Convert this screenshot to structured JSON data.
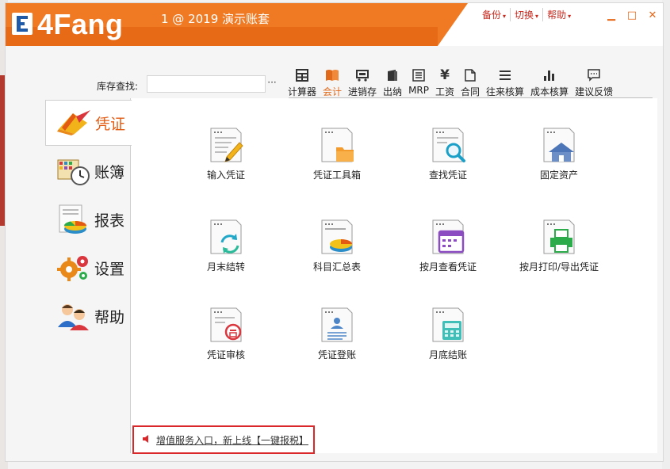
{
  "app": {
    "brand": "4Fang",
    "window_title": "1 @ 2019 演示账套",
    "colors": {
      "brand_orange": "#ef7a23",
      "accent_red": "#d9272a",
      "menu_red": "#c8281c"
    }
  },
  "top_menus": [
    {
      "label": "备份",
      "caret": "▾"
    },
    {
      "label": "切换",
      "caret": "▾"
    },
    {
      "label": "帮助",
      "caret": "▾"
    }
  ],
  "window_controls": {
    "minimize": "▁",
    "maximize": "□",
    "close": "✕"
  },
  "search": {
    "label": "库存查找:",
    "value": "",
    "more": "···"
  },
  "toolbar": [
    {
      "label": "计算器",
      "icon": "calculator-icon",
      "glyph": "▦",
      "active": false
    },
    {
      "label": "会计",
      "icon": "book-icon",
      "glyph": "📖",
      "active": true
    },
    {
      "label": "进销存",
      "icon": "cart-icon",
      "glyph": "⛟",
      "active": false
    },
    {
      "label": "出纳",
      "icon": "wallet-icon",
      "glyph": "▮",
      "active": false
    },
    {
      "label": "MRP",
      "icon": "mrp-icon",
      "glyph": "▤",
      "active": false
    },
    {
      "label": "工资",
      "icon": "yen-icon",
      "glyph": "¥",
      "active": false
    },
    {
      "label": "合同",
      "icon": "document-icon",
      "glyph": "🗋",
      "active": false
    },
    {
      "label": "往来核算",
      "icon": "list-icon",
      "glyph": "☰",
      "active": false
    },
    {
      "label": "成本核算",
      "icon": "bar-chart-icon",
      "glyph": "▂▅▇",
      "active": false
    },
    {
      "label": "建议反馈",
      "icon": "chat-icon",
      "glyph": "▭",
      "active": false
    }
  ],
  "sidebar": [
    {
      "label": "凭证",
      "icon": "voucher-pen-icon",
      "active": true
    },
    {
      "label": "账簿",
      "icon": "ledger-clock-icon",
      "active": false
    },
    {
      "label": "报表",
      "icon": "report-chart-icon",
      "active": false
    },
    {
      "label": "设置",
      "icon": "gears-icon",
      "active": false
    },
    {
      "label": "帮助",
      "icon": "people-icon",
      "active": false
    }
  ],
  "functions": [
    {
      "label": "输入凭证",
      "icon": "input-voucher-icon"
    },
    {
      "label": "凭证工具箱",
      "icon": "voucher-toolbox-icon"
    },
    {
      "label": "查找凭证",
      "icon": "find-voucher-icon"
    },
    {
      "label": "固定资产",
      "icon": "fixed-assets-icon"
    },
    {
      "label": "月末结转",
      "icon": "month-end-transfer-icon"
    },
    {
      "label": "科目汇总表",
      "icon": "subject-summary-icon"
    },
    {
      "label": "按月查看凭证",
      "icon": "monthly-view-icon"
    },
    {
      "label": "按月打印/导出凭证",
      "icon": "print-export-icon"
    },
    {
      "label": "凭证审核",
      "icon": "voucher-audit-icon"
    },
    {
      "label": "凭证登账",
      "icon": "voucher-posting-icon"
    },
    {
      "label": "月底结账",
      "icon": "month-close-icon"
    }
  ],
  "promo": {
    "text": "增值服务入口，新上线【一键报税】",
    "icon": "speaker-icon"
  }
}
